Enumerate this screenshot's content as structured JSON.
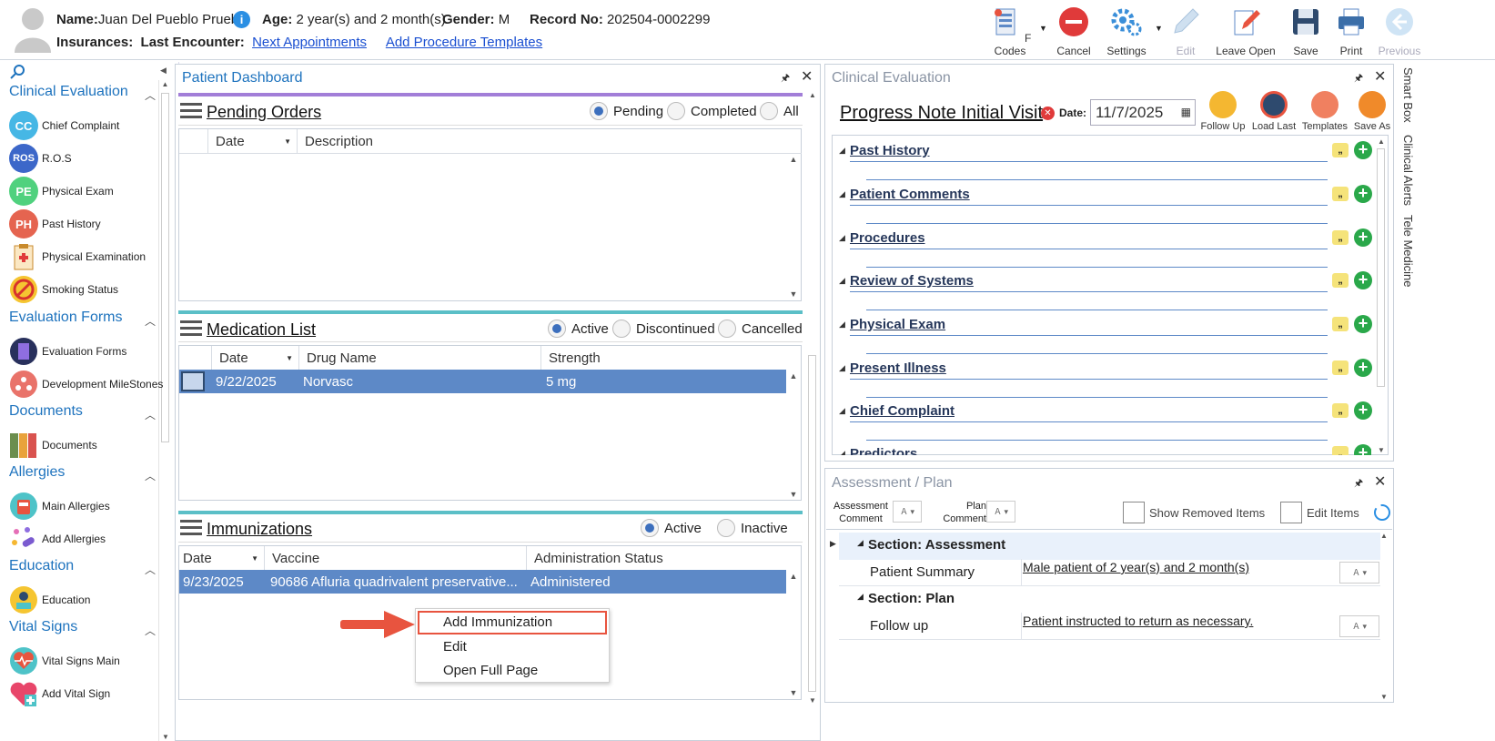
{
  "header": {
    "name_label": "Name:",
    "name_value": "Juan Del Pueblo Prueba",
    "age_label": "Age:",
    "age_value": "2 year(s) and 2 month(s)",
    "gender_label": "Gender:",
    "gender_value": "M",
    "record_label": "Record No:",
    "record_value": "202504-0002299",
    "insurances_label": "Insurances:",
    "last_encounter_label": "Last Encounter:",
    "next_appointments": "Next Appointments",
    "add_procedure_templates": "Add Procedure Templates"
  },
  "toolbar": {
    "fcodes": "F Codes",
    "cancel": "Cancel",
    "settings": "Settings",
    "edit": "Edit",
    "leave_open": "Leave Open",
    "save": "Save",
    "print": "Print",
    "previous": "Previous"
  },
  "sidebar": {
    "sections": [
      {
        "title": "Clinical Evaluation",
        "items": [
          {
            "label": "Chief Complaint",
            "badge": "CC"
          },
          {
            "label": "R.O.S",
            "badge": "ROS"
          },
          {
            "label": "Physical Exam",
            "badge": "PE"
          },
          {
            "label": "Past History",
            "badge": "PH"
          },
          {
            "label": "Physical Examination"
          },
          {
            "label": "Smoking Status"
          }
        ]
      },
      {
        "title": "Evaluation Forms",
        "items": [
          {
            "label": "Evaluation Forms"
          },
          {
            "label": "Development MileStones"
          }
        ]
      },
      {
        "title": "Documents",
        "items": [
          {
            "label": "Documents"
          }
        ]
      },
      {
        "title": "Allergies",
        "items": [
          {
            "label": "Main Allergies"
          },
          {
            "label": "Add Allergies"
          }
        ]
      },
      {
        "title": "Education",
        "items": [
          {
            "label": "Education"
          }
        ]
      },
      {
        "title": "Vital Signs",
        "items": [
          {
            "label": "Vital Signs Main"
          },
          {
            "label": "Add Vital Sign"
          }
        ]
      }
    ]
  },
  "dashboard": {
    "title": "Patient Dashboard",
    "pending_orders": {
      "title": "Pending Orders",
      "radios": [
        "Pending",
        "Completed",
        "All"
      ],
      "selected": "Pending",
      "columns": [
        "Date",
        "Description"
      ]
    },
    "medication_list": {
      "title": "Medication List",
      "radios": [
        "Active",
        "Discontinued",
        "Cancelled"
      ],
      "selected": "Active",
      "columns": [
        "Date",
        "Drug Name",
        "Strength"
      ],
      "rows": [
        {
          "date": "9/22/2025",
          "drug": "Norvasc",
          "strength": "5 mg"
        }
      ]
    },
    "immunizations": {
      "title": "Immunizations",
      "radios": [
        "Active",
        "Inactive"
      ],
      "selected": "Active",
      "columns": [
        "Date",
        "Vaccine",
        "Administration Status"
      ],
      "rows": [
        {
          "date": "9/23/2025",
          "vaccine": "90686 Afluria quadrivalent preservative...",
          "status": "Administered"
        }
      ]
    },
    "context_menu": [
      "Add Immunization",
      "Edit",
      "Open Full Page"
    ]
  },
  "clinical_evaluation": {
    "title": "Clinical Evaluation",
    "note_title": "Progress Note Initial Visit",
    "date_label": "Date:",
    "date_value": "11/7/2025",
    "buttons": [
      "Follow Up",
      "Load Last",
      "Templates",
      "Save As"
    ],
    "sections": [
      "Past History",
      "Patient Comments",
      "Procedures",
      "Review of Systems",
      "Physical Exam",
      "Present Illness",
      "Chief Complaint",
      "Predictors"
    ]
  },
  "assessment_plan": {
    "title": "Assessment / Plan",
    "assessment_comment": "Assessment Comment",
    "plan_comment": "Plan Comment",
    "show_removed": "Show Removed Items",
    "edit_items": "Edit Items",
    "section_assessment": "Section: Assessment",
    "patient_summary_label": "Patient Summary",
    "patient_summary_value": "Male patient of 2 year(s) and 2 month(s)",
    "section_plan": "Section: Plan",
    "follow_up_label": "Follow up",
    "follow_up_value": "Patient instructed to return as necessary."
  },
  "side_tabs": [
    "Smart Box",
    "Clinical Alerts",
    "Tele Medicine"
  ],
  "colors": {
    "accent": "#1e73be",
    "selection": "#5d89c7",
    "arrow": "#e8543f",
    "purple": "#a27ed8",
    "teal": "#5bbfc7"
  }
}
